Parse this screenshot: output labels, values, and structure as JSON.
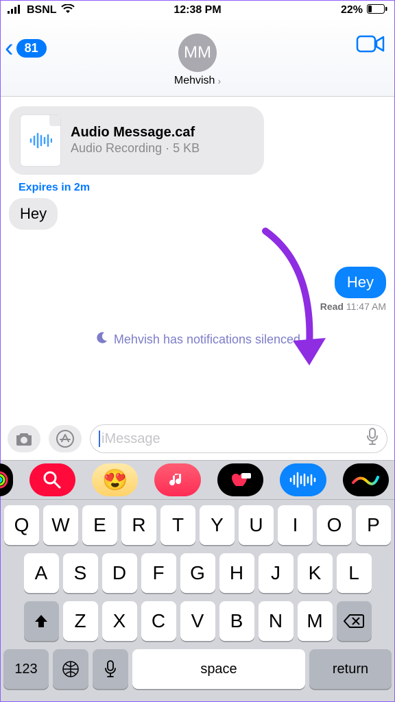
{
  "status": {
    "carrier": "BSNL",
    "time": "12:38 PM",
    "battery_pct": "22%"
  },
  "header": {
    "back_count": "81",
    "avatar_initials": "MM",
    "contact_name": "Mehvish"
  },
  "attachment": {
    "title": "Audio Message.caf",
    "meta": "Audio Recording · 5 KB"
  },
  "expires_label": "Expires in 2m",
  "incoming_text": "Hey",
  "outgoing_text": "Hey",
  "receipt": {
    "status": "Read",
    "time": "11:47 AM"
  },
  "silenced_text": "Mehvish has notifications silenced",
  "compose": {
    "placeholder": "iMessage"
  },
  "keyboard": {
    "row1": [
      "Q",
      "W",
      "E",
      "R",
      "T",
      "Y",
      "U",
      "I",
      "O",
      "P"
    ],
    "row2": [
      "A",
      "S",
      "D",
      "F",
      "G",
      "H",
      "J",
      "K",
      "L"
    ],
    "row3": [
      "Z",
      "X",
      "C",
      "V",
      "B",
      "N",
      "M"
    ],
    "numeric_label": "123",
    "space_label": "space",
    "return_label": "return"
  }
}
